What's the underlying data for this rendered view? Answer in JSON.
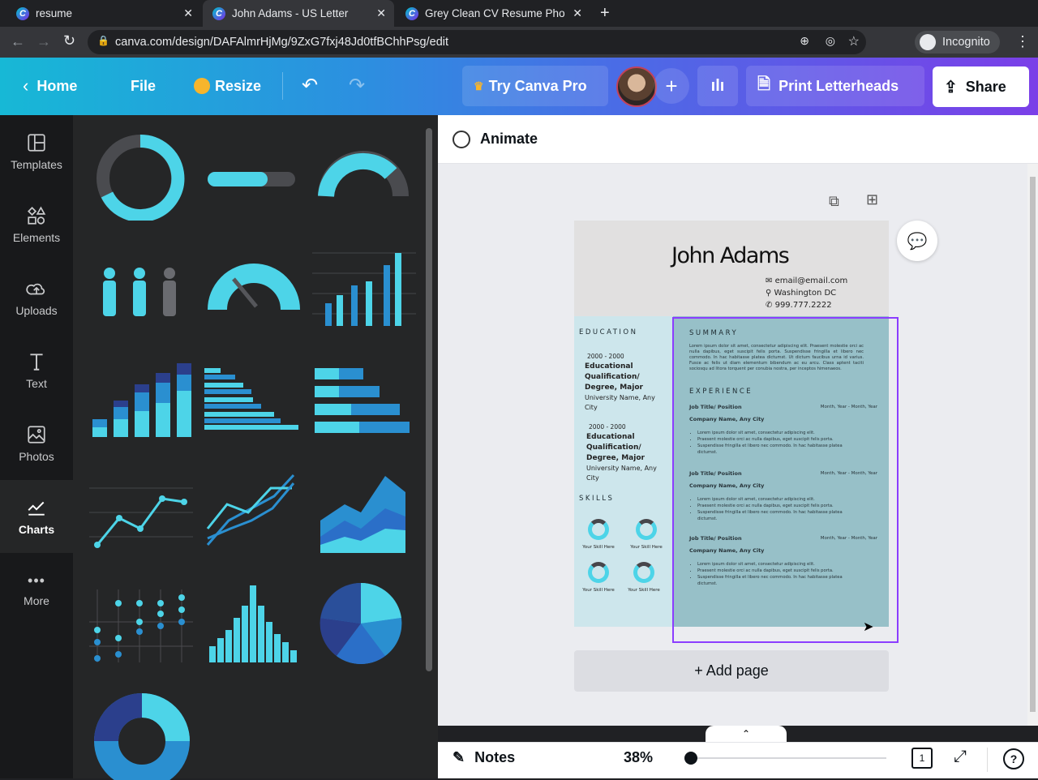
{
  "browser": {
    "tabs": [
      {
        "title": "resume",
        "active": false
      },
      {
        "title": "John Adams - US Letter",
        "active": true
      },
      {
        "title": "Grey Clean CV Resume Pho",
        "active": false
      }
    ],
    "url": "canva.com/design/DAFAlmrHjMg/9ZxG7fxj48Jd0tfBChhPsg/edit",
    "profile": "Incognito"
  },
  "header": {
    "home": "Home",
    "file": "File",
    "resize": "Resize",
    "try_pro": "Try Canva Pro",
    "print": "Print Letterheads",
    "share": "Share"
  },
  "rail": [
    {
      "label": "Templates"
    },
    {
      "label": "Elements"
    },
    {
      "label": "Uploads"
    },
    {
      "label": "Text"
    },
    {
      "label": "Photos"
    },
    {
      "label": "Charts",
      "selected": true
    },
    {
      "label": "More"
    }
  ],
  "toolbar": {
    "animate": "Animate"
  },
  "resume": {
    "name": "John Adams",
    "email": "email@email.com",
    "location": "Washington DC",
    "phone": "999.777.2222",
    "education_heading": "EDUCATION",
    "education": [
      {
        "years": "2000 - 2000",
        "degree": "Educational Qualification/ Degree, Major",
        "school": "University Name, Any City"
      },
      {
        "years": "2000 - 2000",
        "degree": "Educational Qualification/ Degree, Major",
        "school": "University Name, Any City"
      }
    ],
    "skills_heading": "SKILLS",
    "skills": [
      "Your Skill Here",
      "Your Skill Here",
      "Your Skill Here",
      "Your Skill Here"
    ],
    "summary_heading": "SUMMARY",
    "summary": "Lorem ipsum dolor sit amet, consectetur adipiscing elit. Praesent molestie orci ac nulla dapibus, eget suscipit felis porta. Suspendisse fringilla et libero nec commodo. In hac habitasse platea dictumst. Ut dictum faucibus urna id varius. Fusce ac felis ut diam elementum bibendum ac eu arcu. Class aptent taciti sociosqu ad litora torquent per conubia nostra, per inceptos himenaeos.",
    "experience_heading": "EXPERIENCE",
    "jobs": [
      {
        "title": "Job Title/ Position",
        "dates": "Month, Year - Month, Year",
        "company": "Company Name, Any City",
        "bullets": [
          "Lorem ipsum dolor sit amet, consectetur adipiscing elit.",
          "Praesent molestie orci ac nulla dapibus, eget suscipit felis porta.",
          "Suspendisse fringilla et libero nec commodo. In hac habitasse platea dictumst."
        ]
      },
      {
        "title": "Job Title/ Position",
        "dates": "Month, Year - Month, Year",
        "company": "Company Name, Any City",
        "bullets": [
          "Lorem ipsum dolor sit amet, consectetur adipiscing elit.",
          "Praesent molestie orci ac nulla dapibus, eget suscipit felis porta.",
          "Suspendisse fringilla et libero nec commodo. In hac habitasse platea dictumst."
        ]
      },
      {
        "title": "Job Title/ Position",
        "dates": "Month, Year - Month, Year",
        "company": "Company Name, Any City",
        "bullets": [
          "Lorem ipsum dolor sit amet, consectetur adipiscing elit.",
          "Praesent molestie orci ac nulla dapibus, eget suscipit felis porta.",
          "Suspendisse fringilla et libero nec commodo. In hac habitasse platea dictumst."
        ]
      }
    ]
  },
  "canvas": {
    "add_page": "+ Add page"
  },
  "footer": {
    "notes": "Notes",
    "zoom": "38%",
    "zoom_fraction": 0.03,
    "page_count": "1"
  },
  "colors": {
    "accent": "#8b3dff",
    "chart_cyan": "#4dd4e8",
    "chart_blue": "#2a8fd0",
    "chart_navy": "#2b3f8c"
  }
}
